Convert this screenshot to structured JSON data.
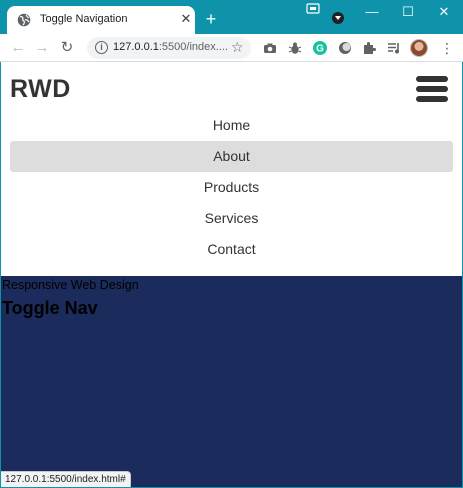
{
  "browser": {
    "tab_title": "Toggle Navigation",
    "tab_close": "✕",
    "new_tab": "+",
    "url_host": "127.0.0.1",
    "url_rest": ":5500/index....",
    "window_controls": [
      "—",
      "☐",
      "✕"
    ],
    "status_url": "127.0.0.1:5500/index.html#"
  },
  "site": {
    "logo": "RWD",
    "nav_items": [
      "Home",
      "About",
      "Products",
      "Services",
      "Contact"
    ],
    "active_item": "About",
    "subtitle": "Responsive Web Design",
    "title": "Toggle Nav"
  },
  "icons": {
    "tab_icon": "globe-icon",
    "info": "info-icon",
    "star": "star-icon",
    "menu": "hamburger-icon"
  },
  "colors": {
    "titlebar": "#0e93ab",
    "page_background": "#1b2b5b",
    "active_nav": "#dddddd",
    "text": "#333333"
  }
}
